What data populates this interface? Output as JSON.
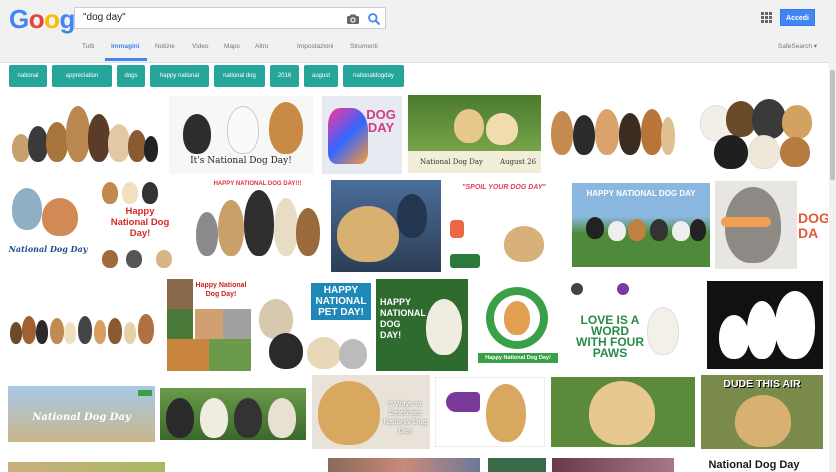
{
  "logo": {
    "letters": [
      "G",
      "o",
      "o",
      "g",
      "l",
      "e"
    ],
    "colors": [
      "#4285f4",
      "#ea4335",
      "#fbbc05",
      "#4285f4",
      "#34a853",
      "#ea4335"
    ]
  },
  "search": {
    "query": "\"dog day\""
  },
  "header": {
    "signin_label": "Accedi",
    "safesearch_label": "SafeSearch ▾"
  },
  "nav": {
    "tabs": [
      {
        "label": "Tutti",
        "active": false
      },
      {
        "label": "Immagini",
        "active": true
      },
      {
        "label": "Notizie",
        "active": false
      },
      {
        "label": "Video",
        "active": false
      },
      {
        "label": "Maps",
        "active": false
      },
      {
        "label": "Altro",
        "active": false
      },
      {
        "label": "Impostazioni",
        "active": false
      },
      {
        "label": "Strumenti",
        "active": false
      }
    ]
  },
  "chips": [
    "national",
    "appreciation",
    "dogs",
    "happy national",
    "national dog",
    "2016",
    "august",
    "nationaldogday"
  ],
  "colors": {
    "accent": "#4285f4",
    "chip": "#26a69a"
  },
  "tiles": [
    {
      "row": 0,
      "caption": ""
    },
    {
      "row": 0,
      "caption": "It's National Dog Day!"
    },
    {
      "row": 0,
      "caption": "DOG DAY"
    },
    {
      "row": 0,
      "caption": "National Dog Day",
      "caption2": "August 26"
    },
    {
      "row": 0,
      "caption": ""
    },
    {
      "row": 0,
      "caption": ""
    },
    {
      "row": 1,
      "caption": "National Dog Day"
    },
    {
      "row": 1,
      "caption": "Happy National Dog Day!"
    },
    {
      "row": 1,
      "caption": "HAPPY NATIONAL DOG DAY!!!"
    },
    {
      "row": 1,
      "caption": ""
    },
    {
      "row": 1,
      "caption": "\"SPOIL YOUR DOG DAY\""
    },
    {
      "row": 1,
      "caption": "HAPPY NATIONAL DOG DAY"
    },
    {
      "row": 1,
      "caption": "DOG DA"
    },
    {
      "row": 2,
      "caption": ""
    },
    {
      "row": 2,
      "caption": "Happy National Dog Day!"
    },
    {
      "row": 2,
      "caption": "HAPPY NATIONAL PET DAY!"
    },
    {
      "row": 2,
      "caption": "HAPPY NATIONAL DOG DAY!"
    },
    {
      "row": 2,
      "caption": "Happy National Dog Day!"
    },
    {
      "row": 2,
      "caption": "LOVE IS A WORD WITH FOUR PAWS"
    },
    {
      "row": 2,
      "caption": ""
    },
    {
      "row": 3,
      "caption": "National Dog Day"
    },
    {
      "row": 3,
      "caption": ""
    },
    {
      "row": 3,
      "caption": "5 Ways to Celebrate National Dog Day"
    },
    {
      "row": 3,
      "caption": ""
    },
    {
      "row": 3,
      "caption": ""
    },
    {
      "row": 3,
      "caption": "DUDE THIS AIR"
    },
    {
      "row": 4,
      "caption": ""
    },
    {
      "row": 4,
      "caption": ""
    },
    {
      "row": 4,
      "caption": ""
    },
    {
      "row": 4,
      "caption": "National Dog Day"
    }
  ]
}
